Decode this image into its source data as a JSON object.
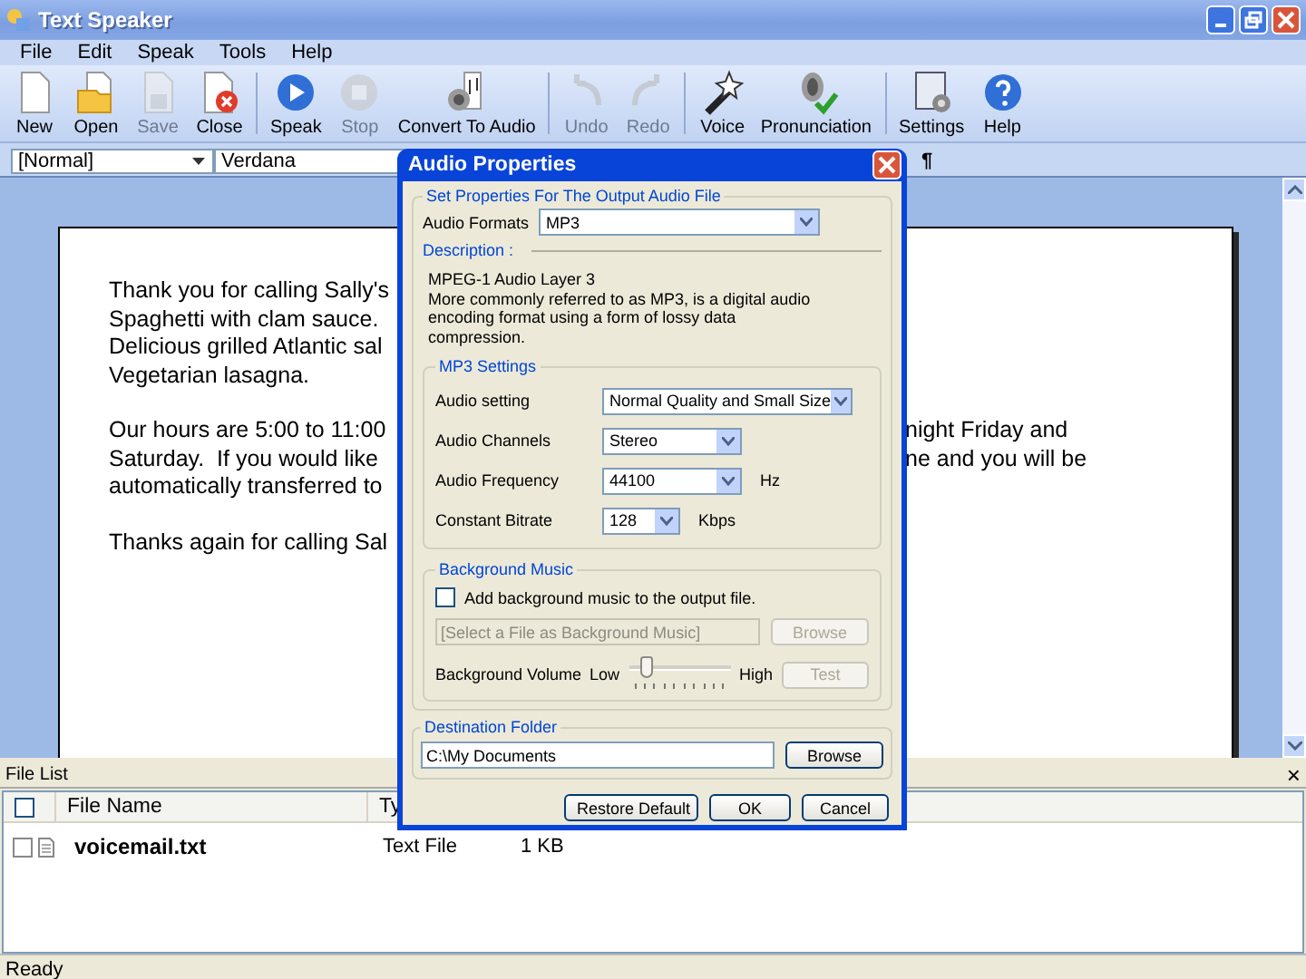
{
  "window": {
    "title": "Text Speaker"
  },
  "menu": [
    "File",
    "Edit",
    "Speak",
    "Tools",
    "Help"
  ],
  "toolbar": {
    "groups": [
      [
        {
          "label": "New",
          "disabled": false
        },
        {
          "label": "Open",
          "disabled": false
        },
        {
          "label": "Save",
          "disabled": true
        },
        {
          "label": "Close",
          "disabled": false
        }
      ],
      [
        {
          "label": "Speak",
          "disabled": false
        },
        {
          "label": "Stop",
          "disabled": true
        },
        {
          "label": "Convert To Audio",
          "disabled": false
        }
      ],
      [
        {
          "label": "Undo",
          "disabled": true
        },
        {
          "label": "Redo",
          "disabled": true
        }
      ],
      [
        {
          "label": "Voice",
          "disabled": false
        },
        {
          "label": "Pronunciation",
          "disabled": false
        }
      ],
      [
        {
          "label": "Settings",
          "disabled": false
        },
        {
          "label": "Help",
          "disabled": false
        }
      ]
    ]
  },
  "format_bar": {
    "style": "[Normal]",
    "font": "Verdana",
    "pilcrow": "¶"
  },
  "document": {
    "paragraphs": [
      [
        {
          "left": "Thank you for calling Sally's"
        },
        {
          "left": "Spaghetti with clam sauce."
        },
        {
          "left": "Delicious grilled Atlantic sal"
        },
        {
          "left": "Vegetarian lasagna."
        }
      ],
      [
        {
          "left": "Our hours are 5:00 to 11:00",
          "right": "night Friday and"
        },
        {
          "left": "Saturday.  If you would like",
          "right": "ne and you will be"
        },
        {
          "left": "automatically transferred to"
        }
      ],
      [
        {
          "left": "Thanks again for calling Sal"
        }
      ]
    ]
  },
  "file_list": {
    "title": "File List",
    "close": "×",
    "columns": [
      "File Name",
      "Ty"
    ],
    "rows": [
      {
        "name": "voicemail.txt",
        "type": "Text File",
        "size": "1 KB",
        "checked": false
      }
    ]
  },
  "status_bar": "Ready",
  "dialog": {
    "title": "Audio Properties",
    "group_title": "Set Properties For The Output Audio File",
    "formats_label": "Audio Formats",
    "format_value": "MP3",
    "description_label": "Description :",
    "description_title": "MPEG-1 Audio Layer 3",
    "description_text": "More commonly referred to as MP3, is a digital audio encoding format using a form of lossy data compression.",
    "mp3": {
      "title": "MP3 Settings",
      "rows": [
        {
          "label": "Audio setting",
          "value": "Normal Quality and Small Size"
        },
        {
          "label": "Audio Channels",
          "value": "Stereo"
        },
        {
          "label": "Audio Frequency",
          "value": "44100",
          "unit": "Hz"
        },
        {
          "label": "Constant Bitrate",
          "value": "128",
          "unit": "Kbps"
        }
      ]
    },
    "bgm": {
      "title": "Background Music",
      "checkbox": {
        "label": "Add background music to the output file.",
        "checked": false
      },
      "file_placeholder": "[Select a File as Background Music]",
      "browse": {
        "label": "Browse",
        "disabled": true
      },
      "volume_label": "Background Volume",
      "low": "Low",
      "high": "High",
      "level": 0.1,
      "test": {
        "label": "Test",
        "disabled": true
      }
    },
    "destination": {
      "title": "Destination Folder",
      "value": "C:\\My Documents",
      "browse": "Browse"
    },
    "buttons": [
      "Restore Default",
      "OK",
      "Cancel"
    ]
  }
}
